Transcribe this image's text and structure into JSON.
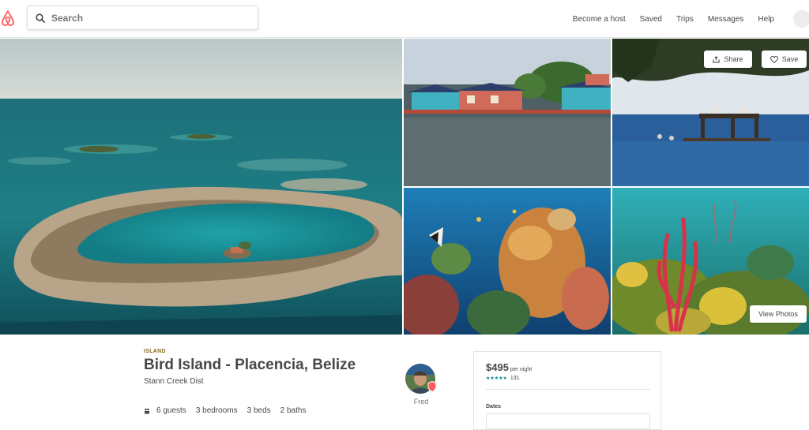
{
  "header": {
    "search_placeholder": "Search",
    "nav": [
      "Become a host",
      "Saved",
      "Trips",
      "Messages",
      "Help"
    ]
  },
  "gallery": {
    "share_label": "Share",
    "save_label": "Save",
    "view_photos_label": "View Photos"
  },
  "listing": {
    "kind": "ISLAND",
    "title": "Bird Island - Placencia, Belize",
    "subtitle": "Stann Creek Dist",
    "amenities": {
      "guests": "6 guests",
      "bedrooms": "3 bedrooms",
      "beds": "3 beds",
      "baths": "2 baths"
    }
  },
  "host": {
    "name": "Fred"
  },
  "booking": {
    "price": "$495",
    "per": "per night",
    "stars": "★★★★★",
    "review_count": "131",
    "dates_label": "Dates"
  },
  "colors": {
    "brand": "#ff5a5f",
    "teal": "#008489",
    "kind": "#8a6a1e"
  }
}
